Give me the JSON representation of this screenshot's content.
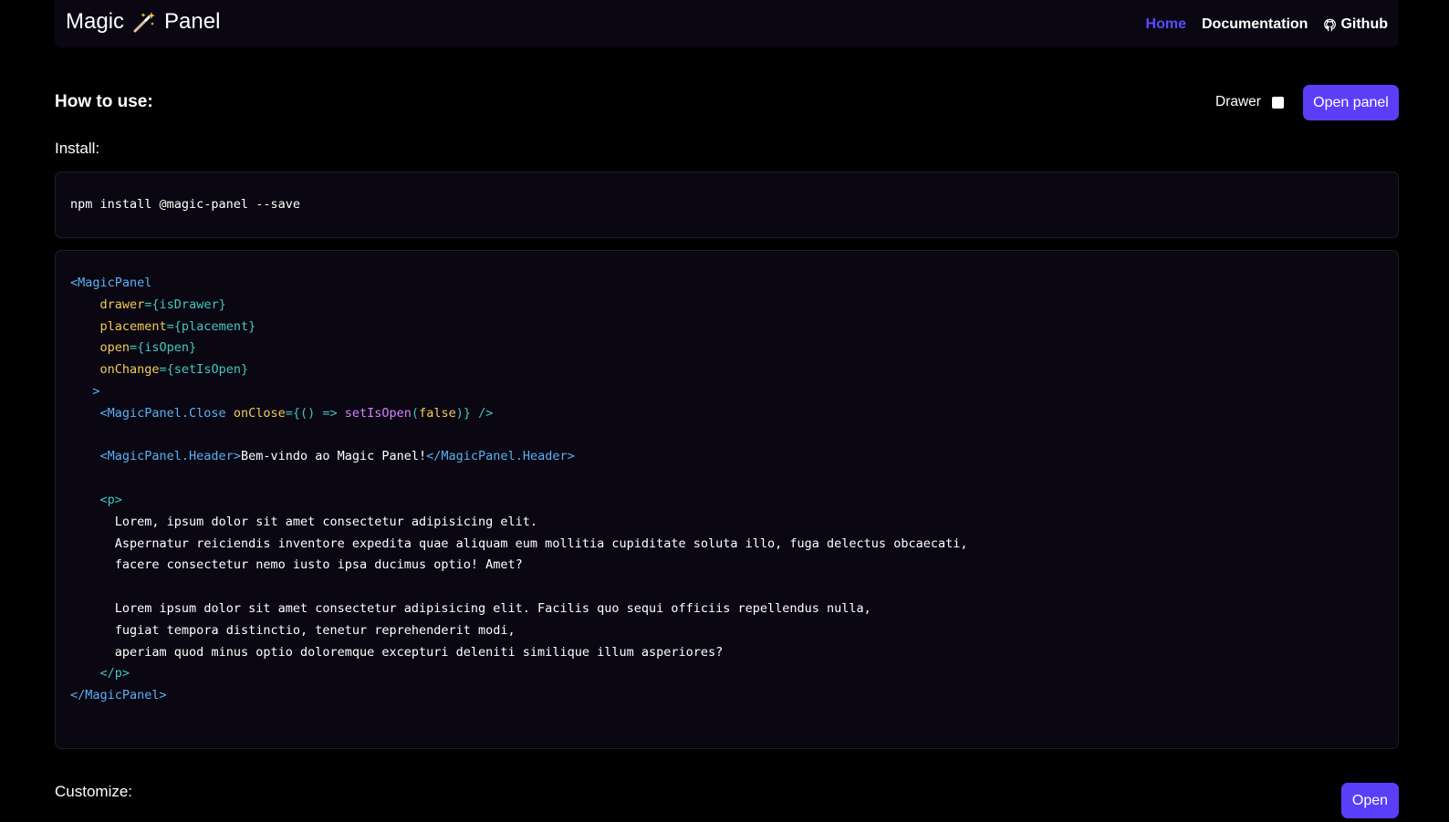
{
  "brand": {
    "name_left": "Magic",
    "name_right": "Panel"
  },
  "nav": {
    "home": "Home",
    "documentation": "Documentation",
    "github": "Github"
  },
  "how_to_use": {
    "title": "How to use:",
    "drawer_label": "Drawer",
    "open_panel_label": "Open panel"
  },
  "install": {
    "label": "Install:",
    "command": "npm install @magic-panel --save"
  },
  "code": {
    "l1": "<MagicPanel",
    "l2_attr": "drawer",
    "l2_val": "={isDrawer}",
    "l3_attr": "placement",
    "l3_val": "={placement}",
    "l4_attr": "open",
    "l4_val": "={isOpen}",
    "l5_attr": "onChange",
    "l5_val": "={setIsOpen}",
    "l6": ">",
    "l7_tag": "<MagicPanel.Close",
    "l7_attr": "onClose",
    "l7_v1": "={() => ",
    "l7_fn": "setIsOpen",
    "l7_v2": "(",
    "l7_kw": "false",
    "l7_v3": ")} />",
    "l9_open": "<MagicPanel.Header>",
    "l9_text": "Bem-vindo ao Magic Panel!",
    "l9_close": "</MagicPanel.Header>",
    "l11": "<p>",
    "l12": "Lorem, ipsum dolor sit amet consectetur adipisicing elit.",
    "l13": "Aspernatur reiciendis inventore expedita quae aliquam eum mollitia cupiditate soluta illo, fuga delectus obcaecati,",
    "l14": "facere consectetur nemo iusto ipsa ducimus optio! Amet?",
    "l16": "Lorem ipsum dolor sit amet consectetur adipisicing elit. Facilis quo sequi officiis repellendus nulla,",
    "l17": "fugiat tempora distinctio, tenetur reprehenderit modi,",
    "l18": "aperiam quod minus optio doloremque excepturi deleniti similique illum asperiores?",
    "l19": "</p>",
    "l20": "</MagicPanel>"
  },
  "customize": {
    "label": "Customize:",
    "open_label": "Open"
  },
  "colors": {
    "accent": "#5b3ff8",
    "nav_active": "#5b4bff",
    "panel_bg": "#0a0713",
    "code_tag": "#5ab1f0",
    "code_attr": "#f2cc55",
    "code_brace": "#43c7bb",
    "code_fn": "#d580ff"
  },
  "icons": {
    "brand": "magic-wand-icon",
    "github": "github-icon",
    "drawer": "checkbox"
  }
}
